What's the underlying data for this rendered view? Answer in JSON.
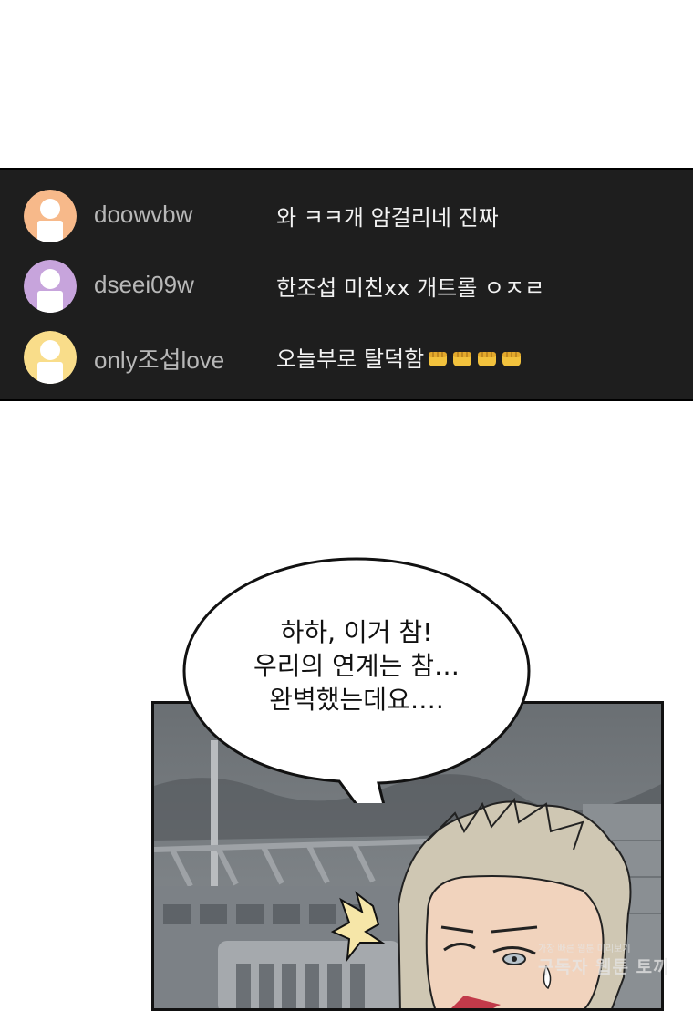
{
  "chat": {
    "comments": [
      {
        "username": "doowvbw",
        "message": "와 ㅋㅋ개 암걸리네 진짜",
        "avatar_color": "#f7b98a"
      },
      {
        "username": "dseei09w",
        "message": "한조섭 미친xx 개트롤 ㅇㅈㄹ",
        "avatar_color": "#c7a4dc"
      },
      {
        "username": "only조섭love",
        "message": "오늘부로 탈덕함",
        "avatar_color": "#f9dd8a",
        "emoji": "fist-icon",
        "emoji_count": 4
      }
    ]
  },
  "speech_bubble": {
    "lines": [
      "하하, 이거 참!",
      "우리의 연계는 참…",
      "완벽했는데요…."
    ]
  },
  "watermark": {
    "line1": "가장 빠른 웹툰 미리보기",
    "line2": "구독자 웹툰 토끼"
  }
}
